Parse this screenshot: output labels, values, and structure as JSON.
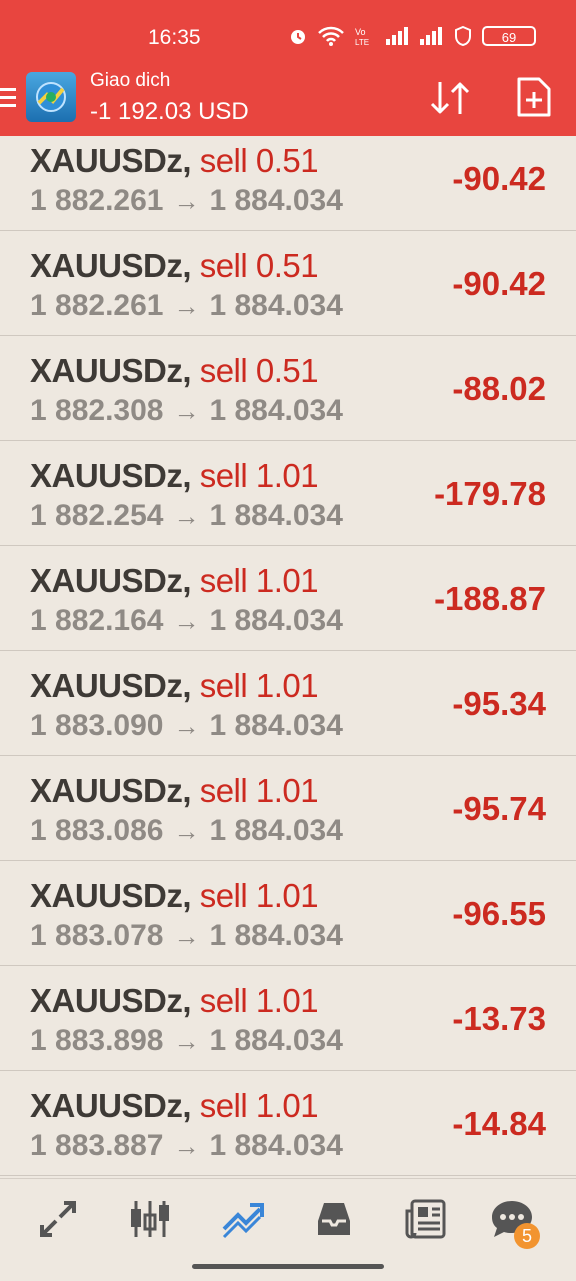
{
  "status_bar": {
    "time": "16:35",
    "battery": "69",
    "icons": [
      "alarm-icon",
      "wifi-icon",
      "volte-icon",
      "signal-icon",
      "signal-icon",
      "vpn-icon",
      "battery-icon"
    ]
  },
  "header": {
    "title": "Giao dich",
    "balance": "-1 192.03 USD",
    "icons": [
      "menu-icon",
      "app-logo",
      "sort-icon",
      "new-order-icon"
    ]
  },
  "colors": {
    "header_bg": "#e8453f",
    "loss": "#cc2a20",
    "symbol": "#3e3a36",
    "price": "#8f8a85",
    "active_nav": "#3a86d8",
    "badge": "#f29430"
  },
  "positions": [
    {
      "symbol": "XAUUSDz,",
      "side": "sell 0.51",
      "open": "1 882.261",
      "arrow": "→",
      "current": "1 884.034",
      "profit": "-90.42"
    },
    {
      "symbol": "XAUUSDz,",
      "side": "sell 0.51",
      "open": "1 882.261",
      "arrow": "→",
      "current": "1 884.034",
      "profit": "-90.42"
    },
    {
      "symbol": "XAUUSDz,",
      "side": "sell 0.51",
      "open": "1 882.308",
      "arrow": "→",
      "current": "1 884.034",
      "profit": "-88.02"
    },
    {
      "symbol": "XAUUSDz,",
      "side": "sell 1.01",
      "open": "1 882.254",
      "arrow": "→",
      "current": "1 884.034",
      "profit": "-179.78"
    },
    {
      "symbol": "XAUUSDz,",
      "side": "sell 1.01",
      "open": "1 882.164",
      "arrow": "→",
      "current": "1 884.034",
      "profit": "-188.87"
    },
    {
      "symbol": "XAUUSDz,",
      "side": "sell 1.01",
      "open": "1 883.090",
      "arrow": "→",
      "current": "1 884.034",
      "profit": "-95.34"
    },
    {
      "symbol": "XAUUSDz,",
      "side": "sell 1.01",
      "open": "1 883.086",
      "arrow": "→",
      "current": "1 884.034",
      "profit": "-95.74"
    },
    {
      "symbol": "XAUUSDz,",
      "side": "sell 1.01",
      "open": "1 883.078",
      "arrow": "→",
      "current": "1 884.034",
      "profit": "-96.55"
    },
    {
      "symbol": "XAUUSDz,",
      "side": "sell 1.01",
      "open": "1 883.898",
      "arrow": "→",
      "current": "1 884.034",
      "profit": "-13.73"
    },
    {
      "symbol": "XAUUSDz,",
      "side": "sell 1.01",
      "open": "1 883.887",
      "arrow": "→",
      "current": "1 884.034",
      "profit": "-14.84"
    }
  ],
  "bottom_nav": {
    "items": [
      "quotes-icon",
      "chart-icon",
      "trade-icon",
      "history-icon",
      "news-icon",
      "messages-icon"
    ],
    "active": "trade-icon",
    "messages_badge": "5"
  }
}
